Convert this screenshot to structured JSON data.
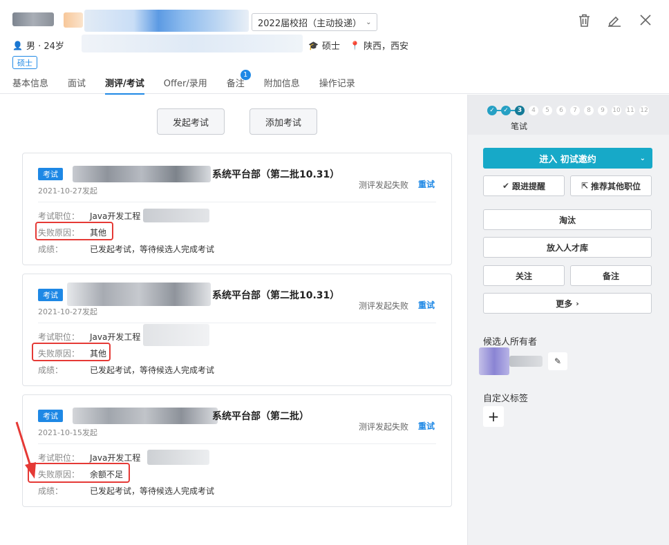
{
  "header": {
    "job_select": "2022届校招（主动投递）",
    "gender_age": "男 · 24岁",
    "education": "硕士",
    "location": "陕西，西安",
    "degree_badge": "硕士",
    "icons": [
      "trash-icon",
      "pencil-icon",
      "close-icon"
    ]
  },
  "tabs": [
    {
      "label": "基本信息"
    },
    {
      "label": "面试"
    },
    {
      "label": "测评/考试",
      "active": true
    },
    {
      "label": "Offer/录用"
    },
    {
      "label": "备注",
      "badge": "1"
    },
    {
      "label": "附加信息"
    },
    {
      "label": "操作记录"
    }
  ],
  "actions": {
    "start_exam": "发起考试",
    "add_exam": "添加考试"
  },
  "cards": [
    {
      "tag": "考试",
      "title": "系统平台部（第二批10.31）",
      "date": "2021-10-27发起",
      "status": "测评发起失败",
      "retry": "重试",
      "position_label": "考试职位：",
      "position_value": "Java开发工程",
      "reason_label": "失败原因：",
      "reason_value": "其他",
      "score_label": "成绩：",
      "score_value": "已发起考试，等待候选人完成考试"
    },
    {
      "tag": "考试",
      "title": "系统平台部（第二批10.31）",
      "date": "2021-10-27发起",
      "status": "测评发起失败",
      "retry": "重试",
      "position_label": "考试职位：",
      "position_value": "Java开发工程",
      "reason_label": "失败原因：",
      "reason_value": "其他",
      "score_label": "成绩：",
      "score_value": "已发起考试，等待候选人完成考试"
    },
    {
      "tag": "考试",
      "title": "系统平台部（第二批）",
      "date": "2021-10-15发起",
      "status": "测评发起失败",
      "retry": "重试",
      "position_label": "考试职位：",
      "position_value": "Java开发工程",
      "reason_label": "失败原因：",
      "reason_value": "余额不足",
      "score_label": "成绩：",
      "score_value": "已发起考试，等待候选人完成考试"
    }
  ],
  "sidebar": {
    "steps": [
      "1",
      "2",
      "3",
      "4",
      "5",
      "6",
      "7",
      "8",
      "9",
      "10",
      "11",
      "12"
    ],
    "current_step": 3,
    "step_label": "笔试",
    "primary": "进入 初试邀约",
    "follow_up": "跟进提醒",
    "recommend": "推荐其他职位",
    "eliminate": "淘汰",
    "talent_pool": "放入人才库",
    "watch": "关注",
    "note": "备注",
    "more": "更多",
    "owner_label": "候选人所有者",
    "tags_label": "自定义标签"
  },
  "colors": {
    "accent": "#1e88e5",
    "primary_teal": "#17a9c8",
    "highlight": "#e53935"
  }
}
